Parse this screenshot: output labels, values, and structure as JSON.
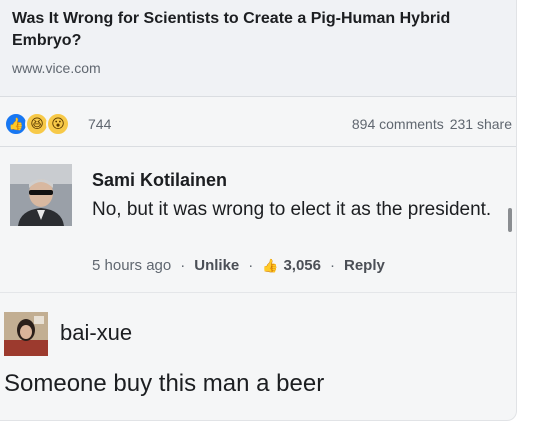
{
  "link_preview": {
    "title": "Was It Wrong for Scientists to Create a Pig-Human Hybrid Embryo?",
    "domain": "www.vice.com"
  },
  "stats": {
    "reaction_icons": [
      "like-icon",
      "haha-icon",
      "wow-icon"
    ],
    "reaction_count": "744",
    "comments": "894 comments",
    "shares": "231 share"
  },
  "comment1": {
    "author": "Sami Kotilainen",
    "text": "No, but it was wrong to elect it as the president.",
    "time": "5 hours ago",
    "unlike": "Unlike",
    "likes": "3,056",
    "reply": "Reply"
  },
  "comment2": {
    "author": "bai-xue",
    "text": "Someone buy this man a beer"
  },
  "colors": {
    "accent_blue": "#1877f2",
    "emoji_yellow": "#f7c948",
    "muted_text": "#606770"
  }
}
